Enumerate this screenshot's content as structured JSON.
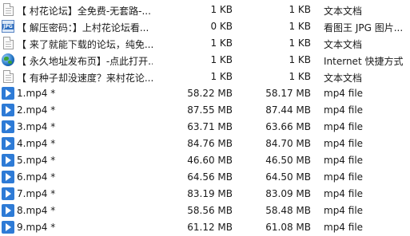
{
  "files": [
    {
      "icon": "text-document-icon",
      "name": "【 村花论坛】全免费-无套路-...",
      "packed": "1 KB",
      "size": "1 KB",
      "type": "文本文档"
    },
    {
      "icon": "jpg-image-icon",
      "name": "【 解压密码：】上村花论坛看...",
      "packed": "0 KB",
      "size": "1 KB",
      "type": "看图王 JPG 图片..."
    },
    {
      "icon": "text-document-icon",
      "name": "【 来了就能下载的论坛，纯免...",
      "packed": "1 KB",
      "size": "1 KB",
      "type": "文本文档"
    },
    {
      "icon": "internet-shortcut-icon",
      "name": "【 永久地址发布页】-点此打开...",
      "packed": "1 KB",
      "size": "1 KB",
      "type": "Internet 快捷方式"
    },
    {
      "icon": "text-document-icon",
      "name": "【 有种子却没速度？来村花论...",
      "packed": "1 KB",
      "size": "1 KB",
      "type": "文本文档"
    },
    {
      "icon": "mp4-video-icon",
      "name": "1.mp4 *",
      "packed": "58.22 MB",
      "size": "58.17 MB",
      "type": "mp4 file"
    },
    {
      "icon": "mp4-video-icon",
      "name": "2.mp4 *",
      "packed": "87.55 MB",
      "size": "87.44 MB",
      "type": "mp4 file"
    },
    {
      "icon": "mp4-video-icon",
      "name": "3.mp4 *",
      "packed": "63.71 MB",
      "size": "63.66 MB",
      "type": "mp4 file"
    },
    {
      "icon": "mp4-video-icon",
      "name": "4.mp4 *",
      "packed": "84.76 MB",
      "size": "84.70 MB",
      "type": "mp4 file"
    },
    {
      "icon": "mp4-video-icon",
      "name": "5.mp4 *",
      "packed": "46.60 MB",
      "size": "46.50 MB",
      "type": "mp4 file"
    },
    {
      "icon": "mp4-video-icon",
      "name": "6.mp4 *",
      "packed": "64.56 MB",
      "size": "64.50 MB",
      "type": "mp4 file"
    },
    {
      "icon": "mp4-video-icon",
      "name": "7.mp4 *",
      "packed": "83.19 MB",
      "size": "83.09 MB",
      "type": "mp4 file"
    },
    {
      "icon": "mp4-video-icon",
      "name": "8.mp4 *",
      "packed": "58.56 MB",
      "size": "58.48 MB",
      "type": "mp4 file"
    },
    {
      "icon": "mp4-video-icon",
      "name": "9.mp4 *",
      "packed": "61.12 MB",
      "size": "61.08 MB",
      "type": "mp4 file"
    }
  ]
}
